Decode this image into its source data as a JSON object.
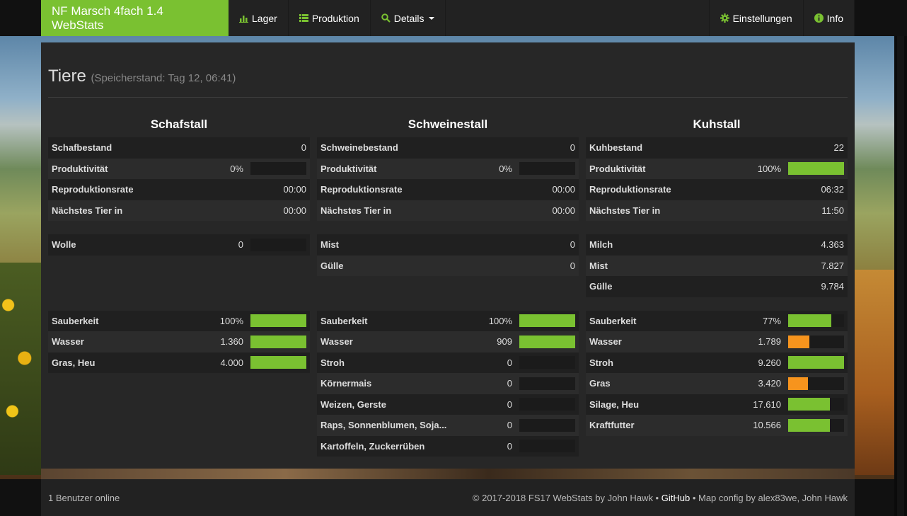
{
  "navbar": {
    "brand": "NF Marsch 4fach 1.4 WebStats",
    "items": [
      {
        "label": "Lager",
        "icon": "bar-chart-icon"
      },
      {
        "label": "Produktion",
        "icon": "list-icon"
      },
      {
        "label": "Details",
        "icon": "search-icon"
      }
    ],
    "right_items": [
      {
        "label": "Einstellungen",
        "icon": "gear-icon"
      },
      {
        "label": "Info",
        "icon": "info-icon"
      }
    ]
  },
  "page": {
    "title": "Tiere",
    "subtitle": "(Speicherstand: Tag 12, 06:41)"
  },
  "colors": {
    "accent": "#7ac131",
    "warn": "#f7941d"
  },
  "stalls": [
    {
      "name": "Schafstall",
      "stats": [
        {
          "label": "Schafbestand",
          "value": "0"
        },
        {
          "label": "Produktivität",
          "value": "0%",
          "bar": 0
        },
        {
          "label": "Reproduktionsrate",
          "value": "00:00"
        },
        {
          "label": "Nächstes Tier in",
          "value": "00:00"
        }
      ],
      "products": [
        {
          "label": "Wolle",
          "value": "0",
          "bar": 0
        }
      ],
      "supplies": [
        {
          "label": "Sauberkeit",
          "value": "100%",
          "bar": 1.0
        },
        {
          "label": "Wasser",
          "value": "1.360",
          "bar": 1.0
        },
        {
          "label": "Gras, Heu",
          "value": "4.000",
          "bar": 1.0
        }
      ]
    },
    {
      "name": "Schweinestall",
      "stats": [
        {
          "label": "Schweinebestand",
          "value": "0"
        },
        {
          "label": "Produktivität",
          "value": "0%",
          "bar": 0
        },
        {
          "label": "Reproduktionsrate",
          "value": "00:00"
        },
        {
          "label": "Nächstes Tier in",
          "value": "00:00"
        }
      ],
      "products": [
        {
          "label": "Mist",
          "value": "0"
        },
        {
          "label": "Gülle",
          "value": "0"
        }
      ],
      "supplies": [
        {
          "label": "Sauberkeit",
          "value": "100%",
          "bar": 1.0
        },
        {
          "label": "Wasser",
          "value": "909",
          "bar": 1.0
        },
        {
          "label": "Stroh",
          "value": "0",
          "bar": 0
        },
        {
          "label": "Körnermais",
          "value": "0",
          "bar": 0
        },
        {
          "label": "Weizen, Gerste",
          "value": "0",
          "bar": 0
        },
        {
          "label": "Raps, Sonnenblumen, Soja...",
          "value": "0",
          "bar": 0
        },
        {
          "label": "Kartoffeln, Zuckerrüben",
          "value": "0",
          "bar": 0
        }
      ]
    },
    {
      "name": "Kuhstall",
      "stats": [
        {
          "label": "Kuhbestand",
          "value": "22"
        },
        {
          "label": "Produktivität",
          "value": "100%",
          "bar": 1.0
        },
        {
          "label": "Reproduktionsrate",
          "value": "06:32"
        },
        {
          "label": "Nächstes Tier in",
          "value": "11:50"
        }
      ],
      "products": [
        {
          "label": "Milch",
          "value": "4.363"
        },
        {
          "label": "Mist",
          "value": "7.827"
        },
        {
          "label": "Gülle",
          "value": "9.784"
        }
      ],
      "supplies": [
        {
          "label": "Sauberkeit",
          "value": "77%",
          "bar": 0.77
        },
        {
          "label": "Wasser",
          "value": "1.789",
          "bar": 0.38,
          "warn": true
        },
        {
          "label": "Stroh",
          "value": "9.260",
          "bar": 1.0
        },
        {
          "label": "Gras",
          "value": "3.420",
          "bar": 0.36,
          "warn": true
        },
        {
          "label": "Silage, Heu",
          "value": "17.610",
          "bar": 0.75
        },
        {
          "label": "Kraftfutter",
          "value": "10.566",
          "bar": 0.75
        }
      ]
    }
  ],
  "footer": {
    "users_online": "1 Benutzer online",
    "copyright": "© 2017-2018 FS17 WebStats by John Hawk •",
    "github": "GitHub",
    "map_config": "• Map config by alex83we, John Hawk"
  }
}
